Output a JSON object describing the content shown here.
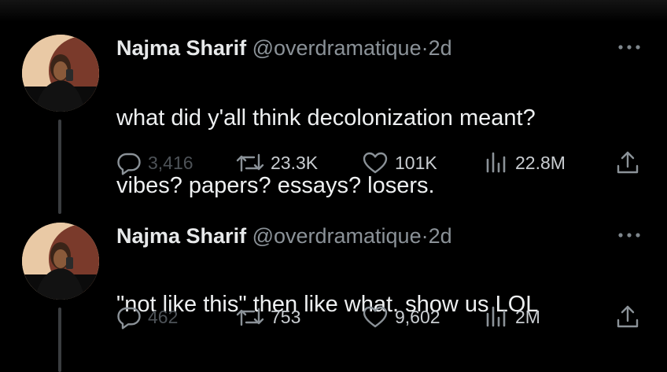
{
  "tweets": [
    {
      "author_name": "Najma Sharif",
      "handle": "@overdramatique",
      "separator": "·",
      "time": "2d",
      "text_lines": [
        "what did y'all think decolonization meant?",
        "vibes? papers? essays? losers."
      ],
      "replies": "3,416",
      "reposts": "23.3K",
      "likes": "101K",
      "views": "22.8M"
    },
    {
      "author_name": "Najma Sharif",
      "handle": "@overdramatique",
      "separator": "·",
      "time": "2d",
      "text_lines": [
        "\"not like this\" then like what. show us LOL"
      ],
      "replies": "462",
      "reposts": "753",
      "likes": "9,602",
      "views": "2M"
    }
  ],
  "icons": [
    "more-icon",
    "reply-icon",
    "repost-icon",
    "like-icon",
    "views-icon",
    "share-icon"
  ],
  "colors": {
    "background": "#000000",
    "text": "#e7e9ea",
    "secondary": "#8b9298",
    "thread_line": "#3a3d40"
  }
}
